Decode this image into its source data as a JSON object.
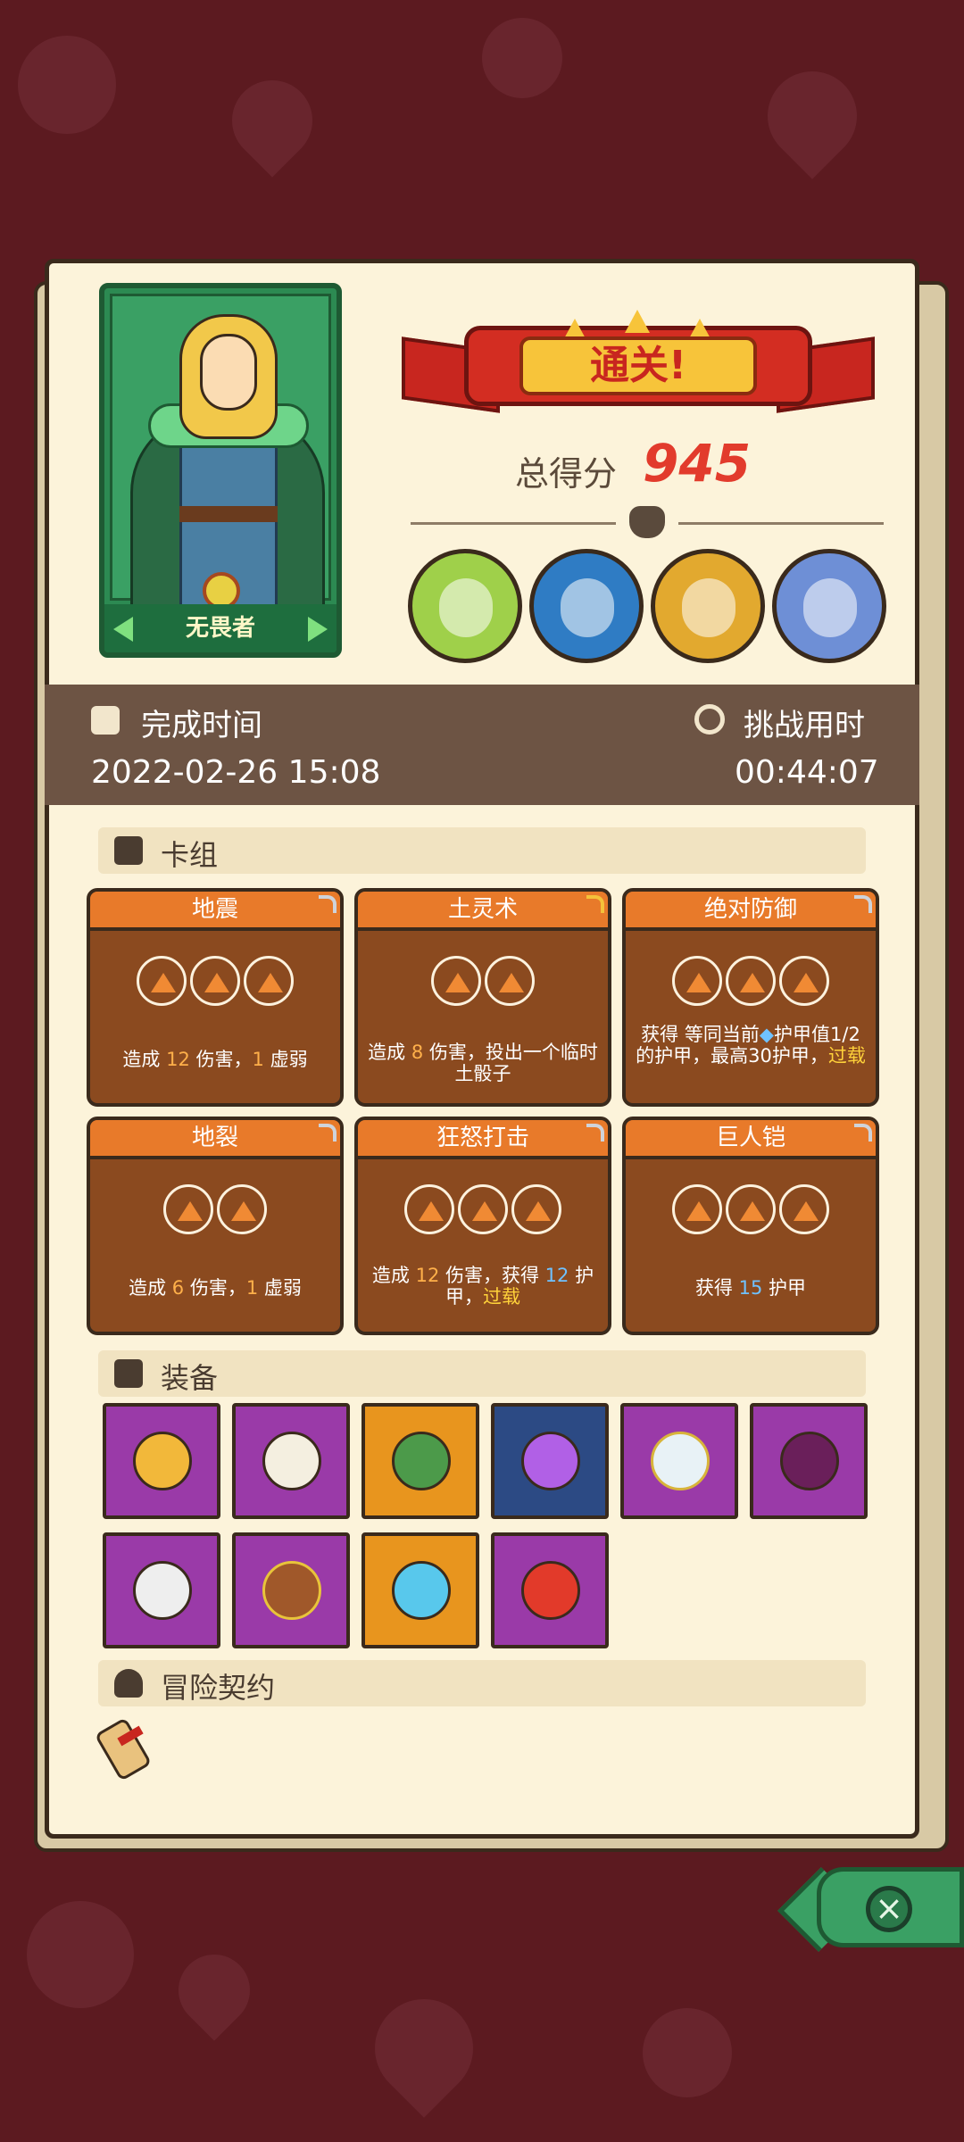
{
  "colors": {
    "background": "#5c1a20",
    "paper": "#fcf3da",
    "score": "#e23b2c",
    "card_header": "#e87a2a",
    "card_body": "#8b4a1f",
    "time_band": "#6d5444"
  },
  "character": {
    "title": "无畏者"
  },
  "banner": {
    "title": "通关!"
  },
  "score": {
    "label": "总得分",
    "value": "945"
  },
  "bosses": [
    {
      "icon": "green-bone-dragon-icon"
    },
    {
      "icon": "blue-squid-king-icon"
    },
    {
      "icon": "yellow-skull-demon-icon"
    },
    {
      "icon": "white-armored-knight-icon"
    }
  ],
  "time": {
    "completion_label": "完成时间",
    "completion_value": "2022-02-26 15:08",
    "duration_label": "挑战用时",
    "duration_value": "00:44:07"
  },
  "deck": {
    "title": "卡组",
    "cards": [
      {
        "name": "地震",
        "cost": 3,
        "desc_pre": "造成 ",
        "desc_num1": "12",
        "desc_mid": " 伤害，",
        "desc_num2": "1",
        "desc_post": " 虚弱"
      },
      {
        "name": "土灵术",
        "cost": 2,
        "desc_pre": "造成 ",
        "desc_num1": "8",
        "desc_mid": " 伤害，投出一个临时土骰子",
        "desc_num2": "",
        "desc_post": ""
      },
      {
        "name": "绝对防御",
        "cost": 3,
        "desc_pre": "获得 等同当前",
        "desc_num1": "",
        "desc_mid": "护甲值1/2的护甲，最高30护甲，",
        "desc_num2": "",
        "desc_post": "过载"
      },
      {
        "name": "地裂",
        "cost": 2,
        "desc_pre": "造成 ",
        "desc_num1": "6",
        "desc_mid": " 伤害，",
        "desc_num2": "1",
        "desc_post": " 虚弱"
      },
      {
        "name": "狂怒打击",
        "cost": 3,
        "desc_pre": "造成 ",
        "desc_num1": "12",
        "desc_mid": " 伤害，获得 ",
        "desc_num2": "12",
        "desc_post": " 护甲，"
      },
      {
        "name": "巨人铠",
        "cost": 3,
        "desc_pre": "获得 ",
        "desc_num1": "15",
        "desc_mid": " 护甲",
        "desc_num2": "",
        "desc_post": ""
      }
    ],
    "overload_word": "过载"
  },
  "equipment": {
    "title": "装备",
    "items": [
      {
        "icon": "golden-glove-icon",
        "rarity": "purple"
      },
      {
        "icon": "fangs-icon",
        "rarity": "purple"
      },
      {
        "icon": "turtle-shell-icon",
        "rarity": "orange"
      },
      {
        "icon": "potion-flask-icon",
        "rarity": "blue"
      },
      {
        "icon": "mirror-icon",
        "rarity": "purple"
      },
      {
        "icon": "vest-icon",
        "rarity": "purple"
      },
      {
        "icon": "cracked-rock-icon",
        "rarity": "purple"
      },
      {
        "icon": "rock-amulet-icon",
        "rarity": "purple"
      },
      {
        "icon": "ice-shield-icon",
        "rarity": "orange"
      },
      {
        "icon": "red-horn-icon",
        "rarity": "purple"
      }
    ]
  },
  "contract": {
    "title": "冒险契约",
    "icon": "scroll-icon"
  },
  "close": {
    "icon": "close-icon"
  }
}
